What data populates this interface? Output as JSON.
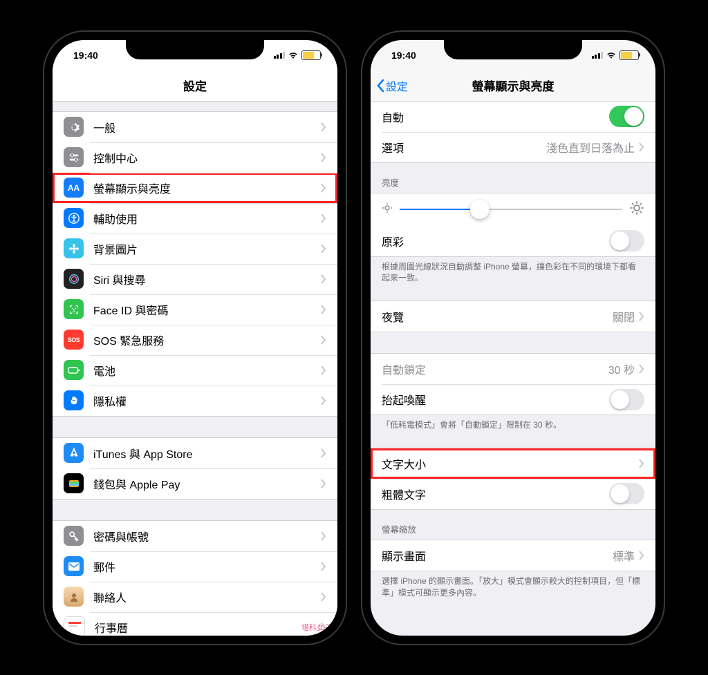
{
  "statusbar": {
    "time": "19:40"
  },
  "left": {
    "title": "設定",
    "rows": {
      "general": "一般",
      "control_center": "控制中心",
      "display": "螢幕顯示與亮度",
      "accessibility": "輔助使用",
      "wallpaper": "背景圖片",
      "siri": "Siri 與搜尋",
      "faceid": "Face ID 與密碼",
      "sos": "SOS 緊急服務",
      "battery": "電池",
      "privacy": "隱私權",
      "appstore": "iTunes 與 App Store",
      "wallet": "錢包與 Apple Pay",
      "passwords": "密碼與帳號",
      "mail": "郵件",
      "contacts": "聯絡人",
      "calendar": "行事曆"
    }
  },
  "right": {
    "back": "設定",
    "title": "螢幕顯示與亮度",
    "auto": {
      "label": "自動"
    },
    "options": {
      "label": "選項",
      "value": "淺色直到日落為止"
    },
    "brightness_header": "亮度",
    "true_tone": "原彩",
    "true_tone_footer": "根據周圍光線狀況自動調整 iPhone 螢幕，讓色彩在不同的環境下都看起來一致。",
    "night_shift": {
      "label": "夜覽",
      "value": "關閉"
    },
    "auto_lock": {
      "label": "自動鎖定",
      "value": "30 秒"
    },
    "raise_to_wake": "抬起喚醒",
    "lpm_footer": "「低耗電模式」會將「自動鎖定」限制在 30 秒。",
    "text_size": "文字大小",
    "bold_text": "粗體文字",
    "zoom_header": "螢幕縮放",
    "display_view": {
      "label": "顯示畫面",
      "value": "標準"
    },
    "zoom_footer": "選擇 iPhone 的顯示畫面。「放大」模式會顯示較大的控制項目，但「標準」模式可顯示更多內容。"
  },
  "watermark": "塔科女子"
}
